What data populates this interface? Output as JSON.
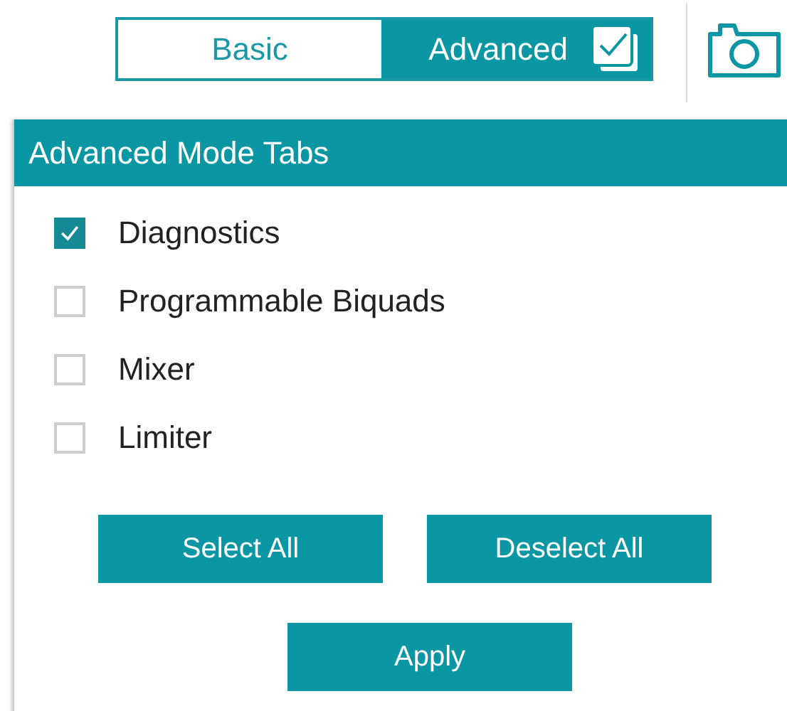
{
  "mode_toggle": [
    {
      "label": "Basic",
      "selected": false
    },
    {
      "label": "Advanced",
      "selected": true
    }
  ],
  "panel": {
    "title": "Advanced Mode Tabs",
    "items": [
      {
        "label": "Diagnostics",
        "checked": true
      },
      {
        "label": "Programmable Biquads",
        "checked": false
      },
      {
        "label": "Mixer",
        "checked": false
      },
      {
        "label": "Limiter",
        "checked": false
      }
    ],
    "buttons": [
      "Select All",
      "Deselect All"
    ],
    "apply_button": "Apply"
  }
}
